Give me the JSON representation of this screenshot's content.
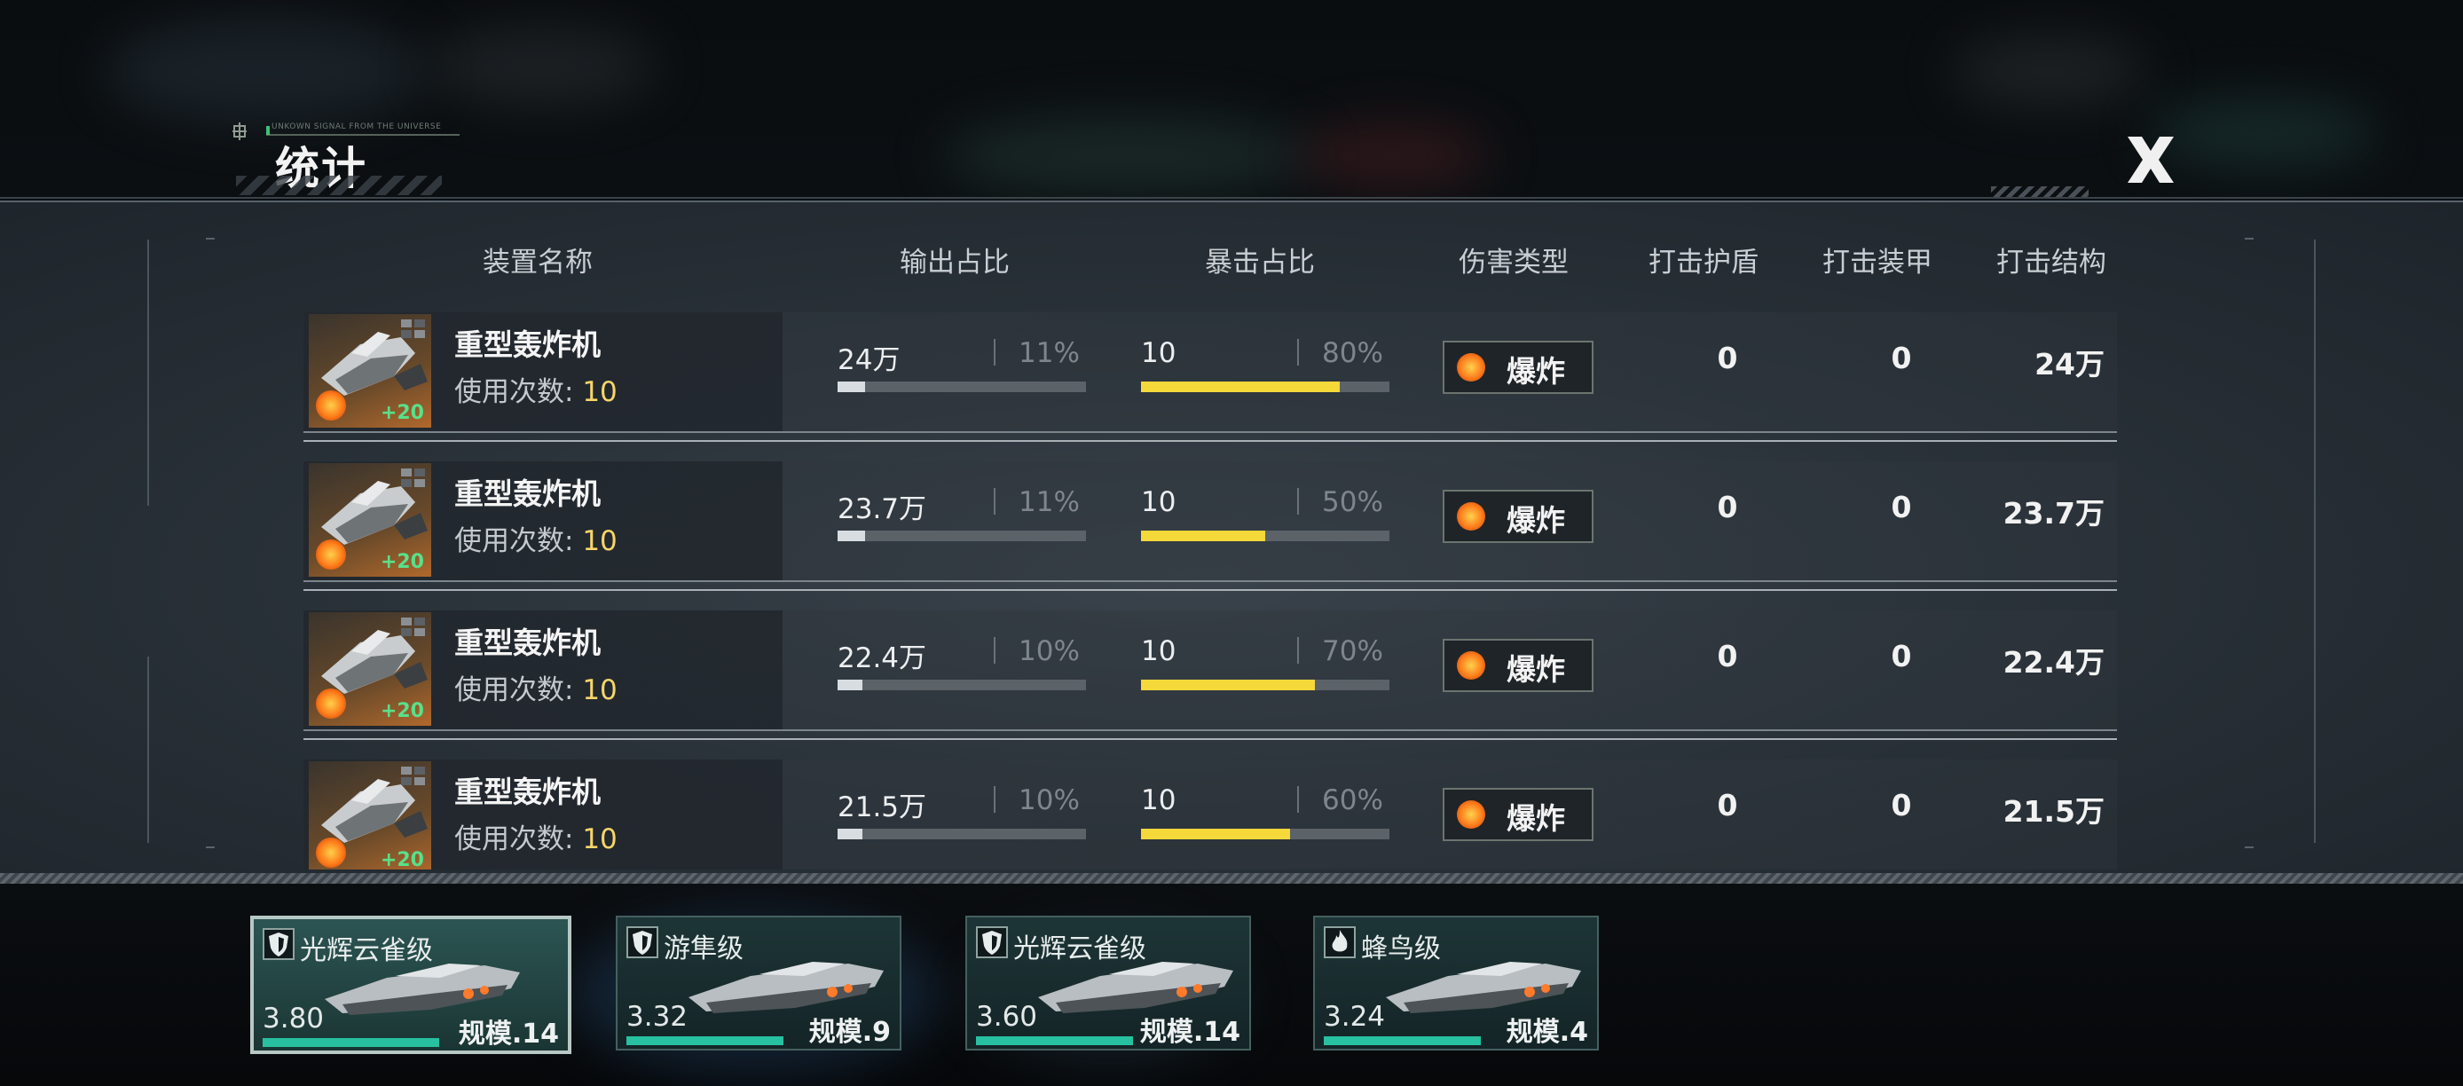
{
  "header": {
    "subtitle": "UNKOWN SIGNAL FROM THE UNIVERSE",
    "title": "统计",
    "close_icon": "close-x-icon"
  },
  "columns": {
    "name": "装置名称",
    "output": "输出占比",
    "crit": "暴击占比",
    "damage_type": "伤害类型",
    "shield": "打击护盾",
    "armor": "打击装甲",
    "structure": "打击结构"
  },
  "rows": [
    {
      "name": "重型轰炸机",
      "usage_label": "使用次数: ",
      "usage": "10",
      "bonus": "+20",
      "output": "24万",
      "output_pct_label": "11%",
      "output_pct": 11,
      "crit": "10",
      "crit_pct_label": "80%",
      "crit_pct": 80,
      "damage_type": "爆炸",
      "shield": "0",
      "armor": "0",
      "structure": "24万"
    },
    {
      "name": "重型轰炸机",
      "usage_label": "使用次数: ",
      "usage": "10",
      "bonus": "+20",
      "output": "23.7万",
      "output_pct_label": "11%",
      "output_pct": 11,
      "crit": "10",
      "crit_pct_label": "50%",
      "crit_pct": 50,
      "damage_type": "爆炸",
      "shield": "0",
      "armor": "0",
      "structure": "23.7万"
    },
    {
      "name": "重型轰炸机",
      "usage_label": "使用次数: ",
      "usage": "10",
      "bonus": "+20",
      "output": "22.4万",
      "output_pct_label": "10%",
      "output_pct": 10,
      "crit": "10",
      "crit_pct_label": "70%",
      "crit_pct": 70,
      "damage_type": "爆炸",
      "shield": "0",
      "armor": "0",
      "structure": "22.4万"
    },
    {
      "name": "重型轰炸机",
      "usage_label": "使用次数: ",
      "usage": "10",
      "bonus": "+20",
      "output": "21.5万",
      "output_pct_label": "10%",
      "output_pct": 10,
      "crit": "10",
      "crit_pct_label": "60%",
      "crit_pct": 60,
      "damage_type": "爆炸",
      "shield": "0",
      "armor": "0",
      "structure": "21.5万"
    }
  ],
  "ships": [
    {
      "name": "光辉云雀级",
      "power": "3.80",
      "scale": "规模.14",
      "icon": "shield-icon",
      "active": true
    },
    {
      "name": "游隼级",
      "power": "3.32",
      "scale": "规模.9",
      "icon": "shield-icon",
      "active": false
    },
    {
      "name": "光辉云雀级",
      "power": "3.60",
      "scale": "规模.14",
      "icon": "shield-icon",
      "active": false
    },
    {
      "name": "蜂鸟级",
      "power": "3.24",
      "scale": "规模.4",
      "icon": "flame-icon",
      "active": false
    }
  ],
  "colors": {
    "crit_bar": "#f5d83a",
    "output_bar": "#d8dde2",
    "usage_number": "#f7d56a",
    "ship_bar": "#27c0a0",
    "bonus": "#58e08a"
  }
}
